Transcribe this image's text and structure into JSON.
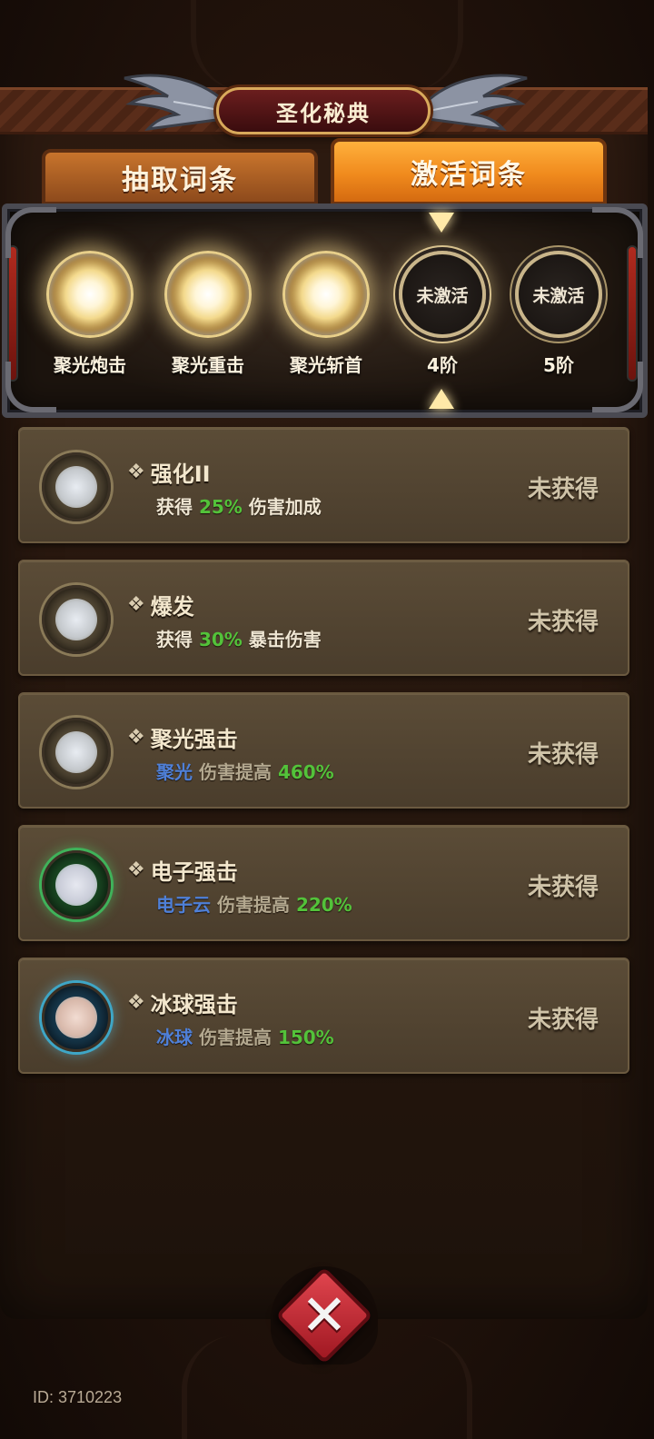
{
  "title": "圣化秘典",
  "tabs": [
    {
      "label": "抽取词条",
      "active": false
    },
    {
      "label": "激活词条",
      "active": true
    }
  ],
  "slots": [
    {
      "label": "聚光炮击",
      "state": "lit",
      "text": ""
    },
    {
      "label": "聚光重击",
      "state": "lit",
      "text": ""
    },
    {
      "label": "聚光斩首",
      "state": "lit",
      "text": ""
    },
    {
      "label": "4阶",
      "state": "locked",
      "text": "未激活"
    },
    {
      "label": "5阶",
      "state": "locked",
      "text": "未激活"
    }
  ],
  "perks": [
    {
      "icon": "gold-orb-icon",
      "title": "强化II",
      "desc": [
        {
          "t": "获得 ",
          "c": ""
        },
        {
          "t": "25%",
          "c": "num"
        },
        {
          "t": " 伤害加成",
          "c": ""
        }
      ],
      "status": "未获得"
    },
    {
      "icon": "gold-orb-icon",
      "title": "爆发",
      "desc": [
        {
          "t": "获得 ",
          "c": ""
        },
        {
          "t": "30%",
          "c": "num"
        },
        {
          "t": " 暴击伤害",
          "c": ""
        }
      ],
      "status": "未获得"
    },
    {
      "icon": "gold-orb-icon",
      "title": "聚光强击",
      "desc": [
        {
          "t": "聚光",
          "c": "skill"
        },
        {
          "t": " 伤害提高 ",
          "c": "dim"
        },
        {
          "t": "460%",
          "c": "num"
        }
      ],
      "status": "未获得"
    },
    {
      "icon": "green-orb-icon",
      "title": "电子强击",
      "desc": [
        {
          "t": "电子云",
          "c": "skill"
        },
        {
          "t": " 伤害提高 ",
          "c": "dim"
        },
        {
          "t": "220%",
          "c": "num"
        }
      ],
      "status": "未获得"
    },
    {
      "icon": "blue-orb-icon",
      "title": "冰球强击",
      "desc": [
        {
          "t": "冰球",
          "c": "skill"
        },
        {
          "t": " 伤害提高 ",
          "c": "dim"
        },
        {
          "t": "150%",
          "c": "num"
        }
      ],
      "status": "未获得"
    }
  ],
  "diamond_glyph": "❖",
  "close_glyph": "✕",
  "id_text": "ID: 3710223",
  "colors": {
    "accent_orange": "#f08a1d",
    "value_green": "#53c23a",
    "skill_blue": "#4f80d8",
    "close_red": "#c4303a"
  }
}
